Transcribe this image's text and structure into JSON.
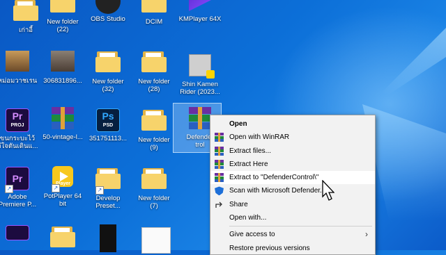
{
  "desktop": {
    "icons": [
      {
        "label": "เก่าอี้"
      },
      {
        "label": "New folder\n(22)"
      },
      {
        "label": "OBS Studio"
      },
      {
        "label": "DCIM"
      },
      {
        "label": "KMPlayer 64X"
      },
      {
        "label": "หม่อมวาชเรน"
      },
      {
        "label": "306831896..."
      },
      {
        "label": "New folder\n(32)"
      },
      {
        "label": "New folder\n(28)"
      },
      {
        "label": "Shin Kamen\nRider (2023..."
      },
      {
        "label": "ขนกระบะไว้\nดีใจตันเดินแ..."
      },
      {
        "label": "50-vintage-l..."
      },
      {
        "label": "351751113..."
      },
      {
        "label": "New folder\n(9)"
      },
      {
        "label": "Defender\ntrol"
      },
      {
        "label": "Adobe\nPremiere P..."
      },
      {
        "label": "PotPlayer 64\nbit"
      },
      {
        "label": "Develop\nPreset..."
      },
      {
        "label": "New folder\n(7)"
      }
    ]
  },
  "context_menu": {
    "items": [
      {
        "label": "Open"
      },
      {
        "label": "Open with WinRAR"
      },
      {
        "label": "Extract files..."
      },
      {
        "label": "Extract Here"
      },
      {
        "label": "Extract to \"DefenderControl\\\""
      },
      {
        "label": "Scan with Microsoft Defender..."
      },
      {
        "label": "Share"
      },
      {
        "label": "Open with..."
      },
      {
        "label": "Give access to"
      },
      {
        "label": "Restore previous versions"
      }
    ],
    "submenu_arrow": "›"
  },
  "icon_text": {
    "pr": "Pr",
    "proj": "PROJ",
    "ps": "Ps",
    "psd": "PSD",
    "player": "Player"
  },
  "colors": {
    "accent": "#0c6fd8",
    "menu_bg": "#f2f2f2",
    "winrar_purple": "#6a2fa0",
    "winrar_green": "#1f8a3a",
    "winrar_blue": "#2a5fc0"
  }
}
